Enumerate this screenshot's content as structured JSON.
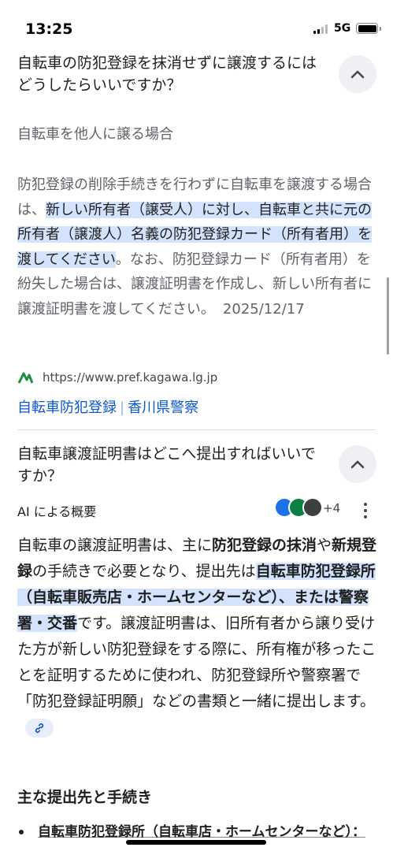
{
  "status_bar": {
    "time": "13:25",
    "network": "5G"
  },
  "q1": {
    "title": "自転車の防犯登録を抹消せずに譲渡するにはどうしたらいいですか？",
    "subhead": "自転車を他人に譲る場合",
    "text_before": "防犯登録の削除手続きを行わずに自転車を譲渡する場合は、",
    "text_highlight": "新しい所有者（譲受人）に対し、自転車と共に元の所有者（譲渡人）名義の防犯登録カード（所有者用）を渡してください",
    "text_after": "。なお、防犯登録カード（所有者用）を紛失した場合は、譲渡証明書を作成し、新しい所有者に譲渡証明書を渡してください。",
    "date": "2025/12/17",
    "source_url": "https://www.pref.kagawa.lg.jp",
    "source_title_a": "自転車防犯登録",
    "source_sep": "|",
    "source_title_b": "香川県警察"
  },
  "q2": {
    "title": "自転車譲渡証明書はどこへ提出すればいいですか？",
    "ai_label": "AI による概要",
    "more_sources": "+4",
    "p1": "自転車の譲渡証明書は、主に",
    "b1": "防犯登録の抹消",
    "p2": "や",
    "b2": "新規登録",
    "p3": "の手続きで必要となり、提出先は",
    "hb": "自転車防犯登録所（自転車販売店・ホームセンターなど）、または警察署・交番",
    "p4": "です。譲渡証明書は、旧所有者から譲り受けた方が新しい防犯登録をする際に、所有権が移ったことを証明するために使われ、防犯登録所や警察署で「防犯登録証明願」などの書類と一緒に提出します。",
    "section_heading": "主な提出先と手続き",
    "bullet1": "自転車防犯登録所（自転車店・ホームセンターなど）："
  },
  "colors": {
    "highlight": "#d3e3fd",
    "link": "#0b57d0",
    "chip": "#eef0f3"
  },
  "icons": [
    "chevron-up-icon",
    "kagawa-logo-icon",
    "link-icon",
    "more-vert-icon"
  ]
}
